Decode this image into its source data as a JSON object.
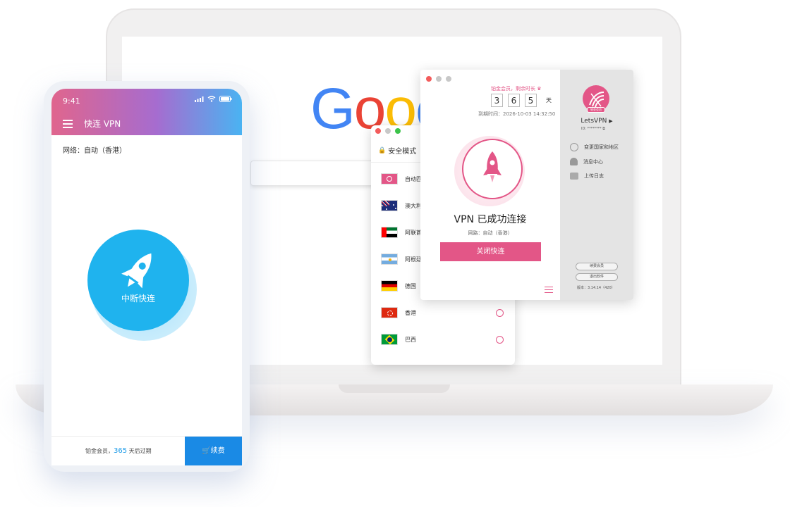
{
  "laptop": {
    "google_logo": [
      "G",
      "o",
      "o",
      "c"
    ]
  },
  "server_window": {
    "safe_mode_label": "安全模式",
    "servers": [
      {
        "name": "自动匹",
        "flag": "auto"
      },
      {
        "name": "澳大利",
        "flag": "au"
      },
      {
        "name": "阿联酋",
        "flag": "ae"
      },
      {
        "name": "阿根廷",
        "flag": "ar"
      },
      {
        "name": "德国",
        "flag": "de"
      },
      {
        "name": "香港",
        "flag": "hk"
      },
      {
        "name": "巴西",
        "flag": "br"
      }
    ]
  },
  "main_window": {
    "member_note": "铂金会员，剩余时长 ♛",
    "days_digits": [
      "3",
      "6",
      "5"
    ],
    "days_unit": "天",
    "expire_time": "到期时间：2026-10-03 14:32:50",
    "status": "VPN 已成功连接",
    "network": "网路：自动（香港）",
    "close_button": "关闭快连",
    "sidebar": {
      "badge_text": "铂金会员",
      "username": "LetsVPN",
      "user_id": "ID: ********",
      "menu": [
        {
          "label": "变更国家和地区",
          "icon": "globe-icon"
        },
        {
          "label": "消息中心",
          "icon": "bell-icon"
        },
        {
          "label": "上传日志",
          "icon": "folder-upload-icon"
        }
      ],
      "renew_label": "续费会员",
      "exit_label": "退出软件",
      "version": "版本：3.14.14（420）"
    }
  },
  "phone": {
    "time": "9:41",
    "title": "快连 VPN",
    "network": "网络：自动（香港）",
    "main_button": "中断快连",
    "member_prefix": "铂金会员，",
    "member_days": "365",
    "member_suffix": "天后过期",
    "renew_button": "续费"
  },
  "colors": {
    "accent_pink": "#e35687",
    "phone_blue": "#1fb3ee",
    "renew_blue": "#1a8ae5"
  }
}
